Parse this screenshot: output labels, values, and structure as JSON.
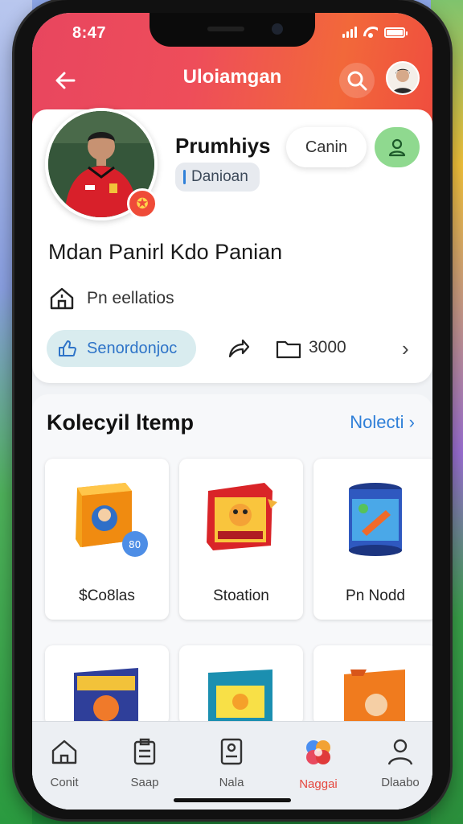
{
  "status": {
    "time": "8:47"
  },
  "header": {
    "title": "Uloiamgan"
  },
  "profile": {
    "name": "Prumhiys",
    "role": "Danioan",
    "contact_label": "Canin",
    "subtitle": "Mdan Panirl Kdo Panian",
    "meta_text": "Pn eellatios",
    "sensor_label": "Senordonjoc",
    "count": "3000"
  },
  "collection": {
    "title": "Kolecyil ltemp",
    "see_all": "Nolecti",
    "items": [
      {
        "label": "$Co8las"
      },
      {
        "label": "Stoation"
      },
      {
        "label": "Pn Nodd"
      }
    ]
  },
  "nav": {
    "items": [
      {
        "label": "Conit"
      },
      {
        "label": "Saap"
      },
      {
        "label": "Nala"
      },
      {
        "label": "Naggai"
      },
      {
        "label": "Dlaabo"
      }
    ],
    "active_index": 3
  },
  "colors": {
    "accent": "#ee4d5a",
    "link": "#2f7fd8",
    "follow": "#8fd98f"
  }
}
